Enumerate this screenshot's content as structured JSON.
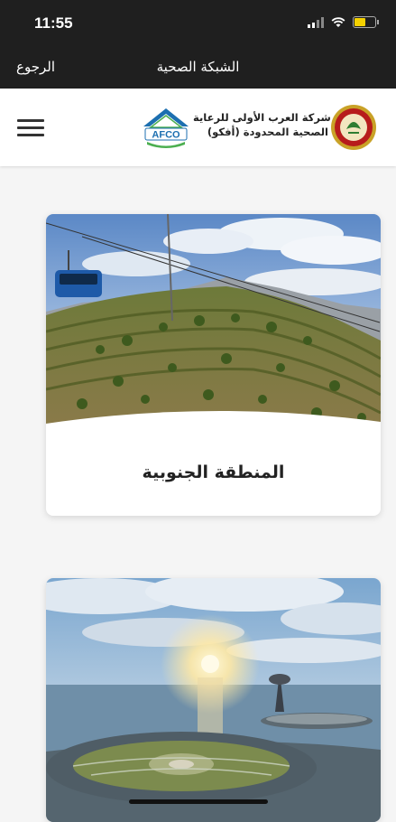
{
  "status_bar": {
    "time": "11:55",
    "battery_level": 0.55
  },
  "nav": {
    "back_label": "الرجوع",
    "title": "الشبكة الصحية"
  },
  "header": {
    "company_line1": "شركة العرب الأولى للرعاية",
    "company_line2": "الصحية المحدودة (أفكو)",
    "afco_logo_text": "AFCO"
  },
  "cards": [
    {
      "title": "المنطقة الجنوبية"
    }
  ],
  "colors": {
    "bar": "#1f1f1f",
    "afco_blue": "#1c6fb0",
    "afco_green": "#4caf50",
    "seal_red": "#b71c1c"
  }
}
